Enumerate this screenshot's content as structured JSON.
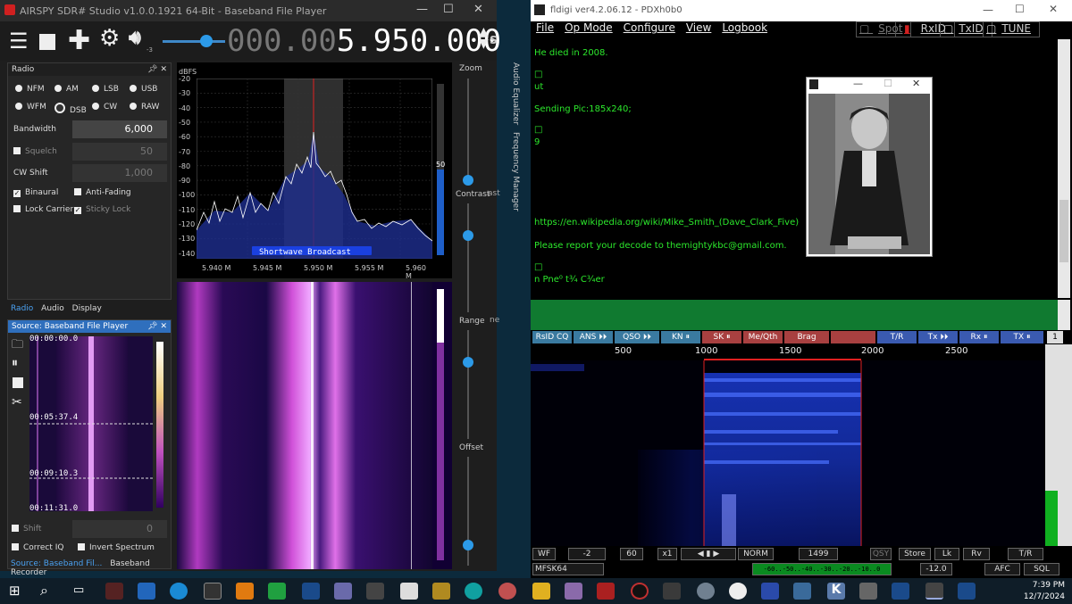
{
  "airspy": {
    "title": "AIRSPY SDR# Studio v1.0.0.1921 64-Bit - Baseband File Player",
    "freq_dim": "000.00",
    "freq_bright": "5.950.000",
    "brand": "SPY",
    "vol": "-3",
    "radio_panel": {
      "header": "Radio",
      "modes": [
        "NFM",
        "AM",
        "LSB",
        "USB",
        "WFM",
        "DSB",
        "CW",
        "RAW"
      ],
      "selected_mode": "DSB",
      "bandwidth_label": "Bandwidth",
      "bandwidth": "6,000",
      "squelch_label": "Squelch",
      "squelch": "50",
      "cw_shift_label": "CW Shift",
      "cw_shift": "1,000",
      "binaural": "Binaural",
      "anti_fading": "Anti-Fading",
      "lock_carrier": "Lock Carrier",
      "sticky_lock": "Sticky Lock",
      "tabs": [
        "Radio",
        "Audio",
        "Display"
      ]
    },
    "source_panel": {
      "header": "Source: Baseband File Player",
      "times": [
        "00:00:00.0",
        "00:05:37.4",
        "00:09:10.3",
        "00:11:31.0"
      ],
      "shift_label": "Shift",
      "shift": "0",
      "correct_iq": "Correct IQ",
      "invert_spectrum": "Invert Spectrum",
      "tabs": [
        "Source: Baseband Fil...",
        "Baseband Recorder"
      ]
    },
    "spectrum": {
      "unit": "dBFS",
      "yticks": [
        "-20",
        "-30",
        "-40",
        "-50",
        "-60",
        "-70",
        "-80",
        "-90",
        "-100",
        "-110",
        "-120",
        "-130",
        "-140"
      ],
      "xticks": [
        "5.940 M",
        "5.945 M",
        "5.950 M",
        "5.955 M",
        "5.960 M"
      ],
      "band_label": "Shortwave Broadcast",
      "level": "50"
    },
    "sliders": [
      "Zoom",
      "Contrast",
      "Range",
      "Offset"
    ],
    "side_tabs": [
      "Audio Equalizer",
      "Frequency Manager"
    ],
    "peek": [
      "ast",
      "ne"
    ]
  },
  "fldigi": {
    "title": "fldigi ver4.2.06.12 - PDXh0b0",
    "menu": [
      "File",
      "Op Mode",
      "Configure",
      "View",
      "Logbook"
    ],
    "toggles": {
      "spot": "Spot",
      "rxid": "RxID",
      "txid": "TxID",
      "tune": "TUNE"
    },
    "rx_lines": [
      "He died in 2008.",
      "□",
      "ut",
      "Sending Pic:185x240;",
      "□",
      "9",
      "https://en.wikipedia.org/wiki/Mike_Smith_(Dave_Clark_Five)",
      "Please report your decode to themightykbc@gmail.com.",
      "□",
      "n Pne⁰  t¾ C¾er"
    ],
    "macros": [
      "RsID CQ",
      "ANS ⏵⏵",
      "QSO ⏵⏵",
      "KN ⏸",
      "SK ⏸",
      "Me/Qth",
      "Brag",
      "",
      "T/R",
      "Tx ⏵⏵",
      "Rx ⏸",
      "TX ⏸"
    ],
    "macro_page": "1",
    "scale": [
      "500",
      "1000",
      "1500",
      "2000",
      "2500"
    ],
    "ctrl": {
      "wf": "WF",
      "wf_lo": "-2",
      "wf_rng": "60",
      "x1": "x1",
      "norm": "NORM",
      "freq": "1499",
      "qsy": "QSY",
      "store": "Store",
      "lk": "Lk",
      "rv": "Rv",
      "tr": "T/R",
      "mode": "MFSK64",
      "sq_lvl": "-12.0",
      "afc": "AFC",
      "sql": "SQL",
      "meter": "-60..-50..-40..-30..-20..-10..0"
    }
  },
  "picture_window": {
    "title": ""
  },
  "taskbar": {
    "time": "7:39 PM",
    "date": "12/7/2024"
  },
  "colors": {
    "accent_blue": "#2f6fbd",
    "rx_text": "#2ce82c",
    "tx_green": "#107a30",
    "wf_purple": "#d13fd8"
  }
}
